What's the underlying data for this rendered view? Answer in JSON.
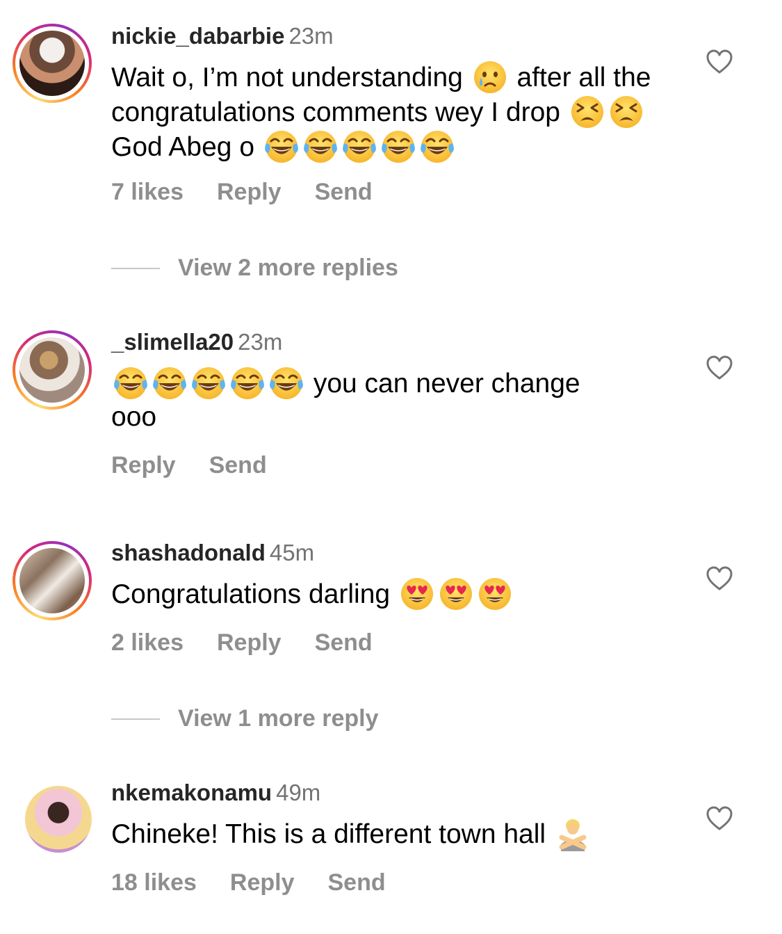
{
  "comments": [
    {
      "username": "nickie_dabarbie",
      "time": "23m",
      "text_parts": [
        "Wait o, I’m not understanding",
        "after all the congratulations comments wey I drop",
        "God Abeg o"
      ],
      "likes": "7 likes",
      "reply": "Reply",
      "send": "Send",
      "view_more": "View 2 more replies",
      "emojis": [
        "crying-face-emoji",
        "tired-face-emoji",
        "tears-of-joy-emoji"
      ]
    },
    {
      "username": "_slimella20",
      "time": "23m",
      "text_parts": [
        "you can never change",
        "ooo"
      ],
      "reply": "Reply",
      "send": "Send",
      "emojis": [
        "tears-of-joy-emoji"
      ]
    },
    {
      "username": "shashadonald",
      "time": "45m",
      "text_parts": [
        "Congratulations darling"
      ],
      "likes": "2 likes",
      "reply": "Reply",
      "send": "Send",
      "view_more": "View 1 more reply",
      "emojis": [
        "heart-eyes-emoji"
      ]
    },
    {
      "username": "nkemakonamu",
      "time": "49m",
      "text_parts": [
        "Chineke! This is a different town hall"
      ],
      "likes": "18 likes",
      "reply": "Reply",
      "send": "Send",
      "emojis": [
        "person-gesturing-no-emoji"
      ]
    }
  ],
  "colors": {
    "username": "#262626",
    "meta": "#737373",
    "action": "#8e8e8e",
    "story_ring": [
      "#feda75",
      "#fa7e1e",
      "#d62976",
      "#962fbf"
    ]
  }
}
